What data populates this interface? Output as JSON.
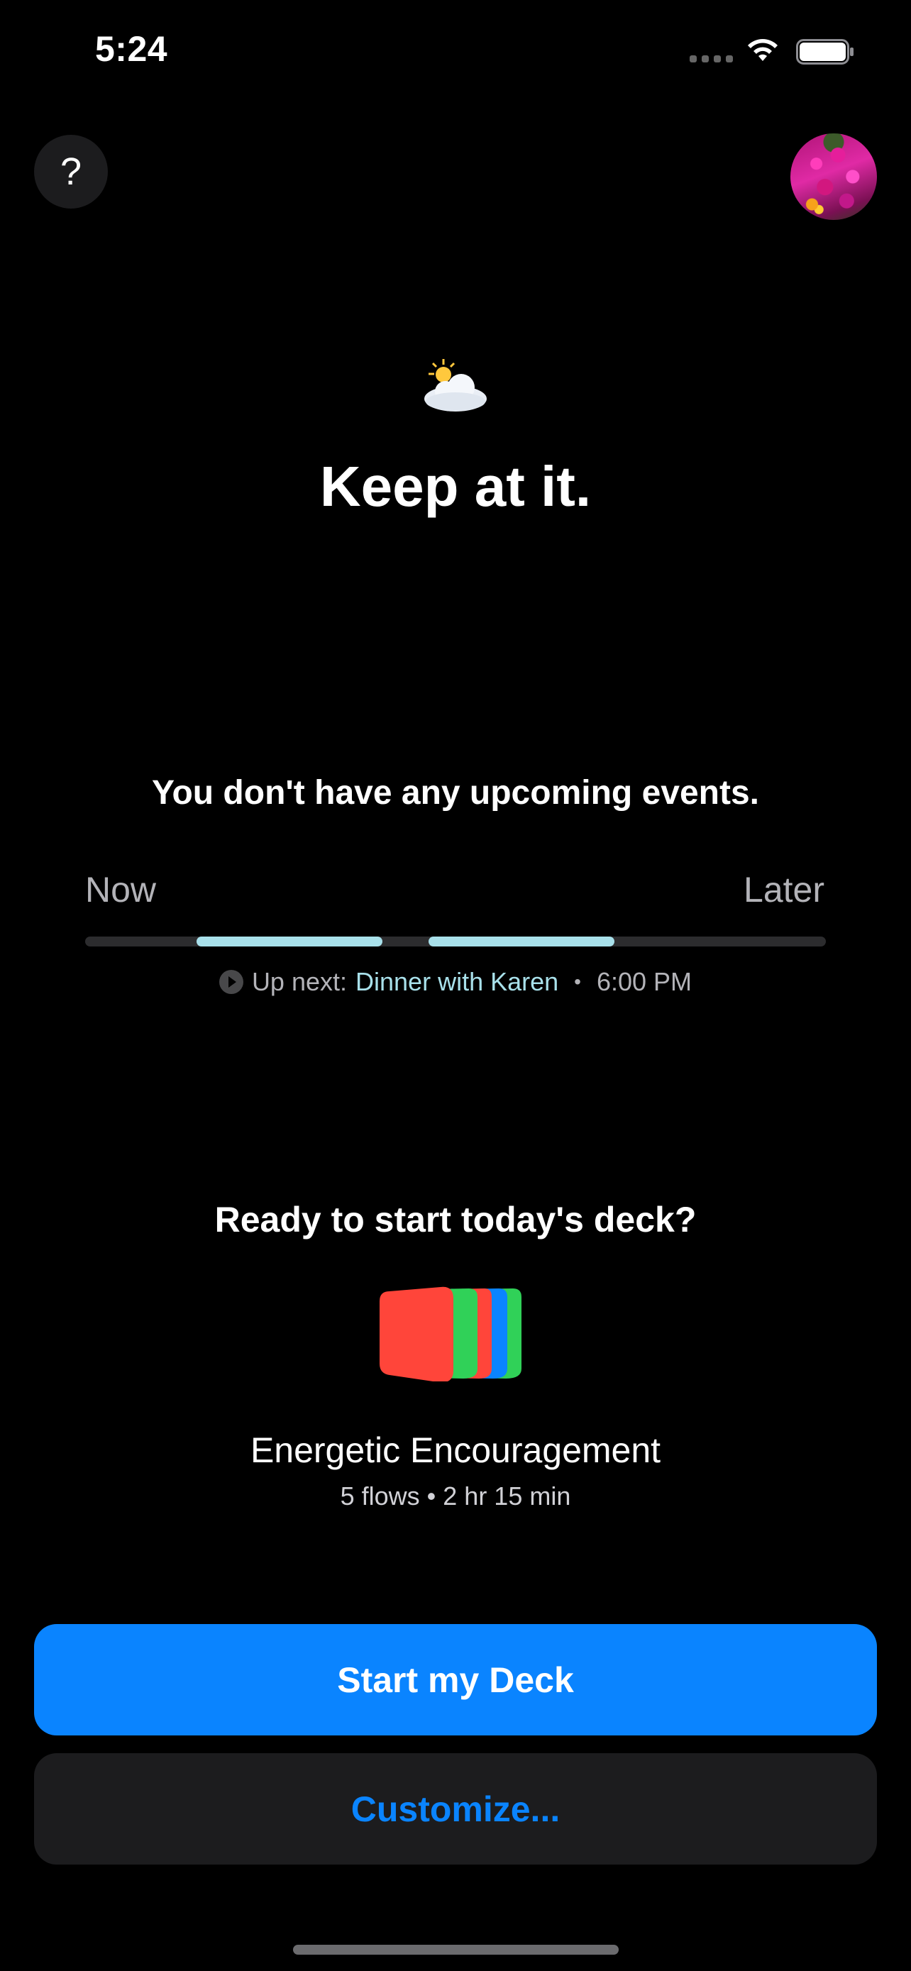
{
  "status_bar": {
    "time": "5:24",
    "icons": [
      "cellular-signal-icon",
      "wifi-icon",
      "battery-icon"
    ]
  },
  "header": {
    "help_label": "?",
    "avatar_icon": "profile-avatar"
  },
  "greeting": {
    "weather_icon": "sun-behind-cloud-icon",
    "title": "Keep at it."
  },
  "events": {
    "message": "You don't have any upcoming events.",
    "timeline_start": "Now",
    "timeline_end": "Later",
    "up_next_prefix": "Up next:",
    "up_next_event": "Dinner with Karen",
    "separator": "•",
    "up_next_time": "6:00 PM",
    "accent_color": "#a8e0ea"
  },
  "deck": {
    "question": "Ready to start today's deck?",
    "name": "Energetic Encouragement",
    "meta": "5 flows • 2 hr 15 min",
    "card_colors": [
      "#ff453a",
      "#30d158",
      "#ff453a",
      "#0a84ff",
      "#30d158"
    ]
  },
  "actions": {
    "start_label": "Start my Deck",
    "customize_label": "Customize...",
    "primary_color": "#0a84ff"
  }
}
